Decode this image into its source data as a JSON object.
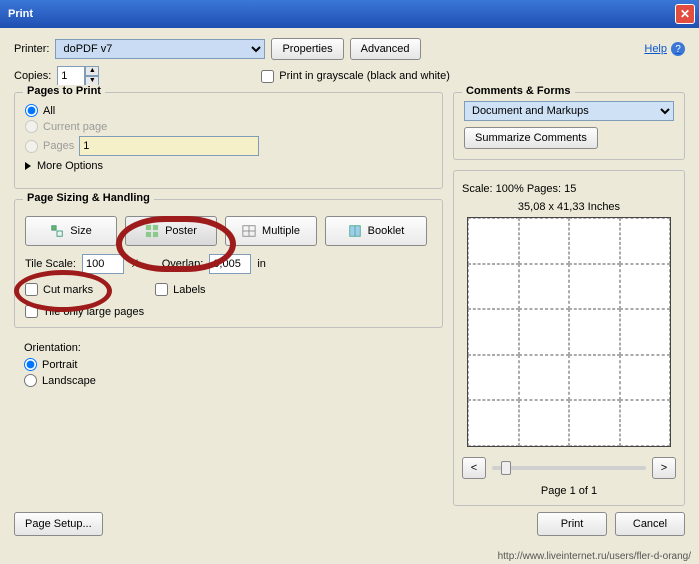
{
  "title": "Print",
  "help": "Help",
  "printer": {
    "label": "Printer:",
    "value": "doPDF v7",
    "properties": "Properties",
    "advanced": "Advanced"
  },
  "copies": {
    "label": "Copies:",
    "value": "1"
  },
  "grayscale": "Print in grayscale (black and white)",
  "pages": {
    "title": "Pages to Print",
    "all": "All",
    "current": "Current page",
    "range": "Pages",
    "range_value": "1",
    "more": "More Options"
  },
  "sizing": {
    "title": "Page Sizing & Handling",
    "size": "Size",
    "poster": "Poster",
    "multiple": "Multiple",
    "booklet": "Booklet",
    "tile_scale_lbl": "Tile Scale:",
    "tile_scale": "100",
    "pct": "%",
    "overlap_lbl": "Overlap:",
    "overlap": "0,005",
    "unit": "in",
    "cutmarks": "Cut marks",
    "labels": "Labels",
    "tile_large": "Tile only large pages"
  },
  "orient": {
    "title": "Orientation:",
    "portrait": "Portrait",
    "landscape": "Landscape"
  },
  "cf": {
    "title": "Comments & Forms",
    "value": "Document and Markups",
    "summarize": "Summarize Comments"
  },
  "preview": {
    "scale": "Scale: 100% Pages: 15",
    "dim": "35,08 x 41,33 Inches",
    "page": "Page 1 of 1"
  },
  "footer": {
    "setup": "Page Setup...",
    "print": "Print",
    "cancel": "Cancel"
  },
  "watermark": "http://www.liveinternet.ru/users/fler-d-orang/"
}
